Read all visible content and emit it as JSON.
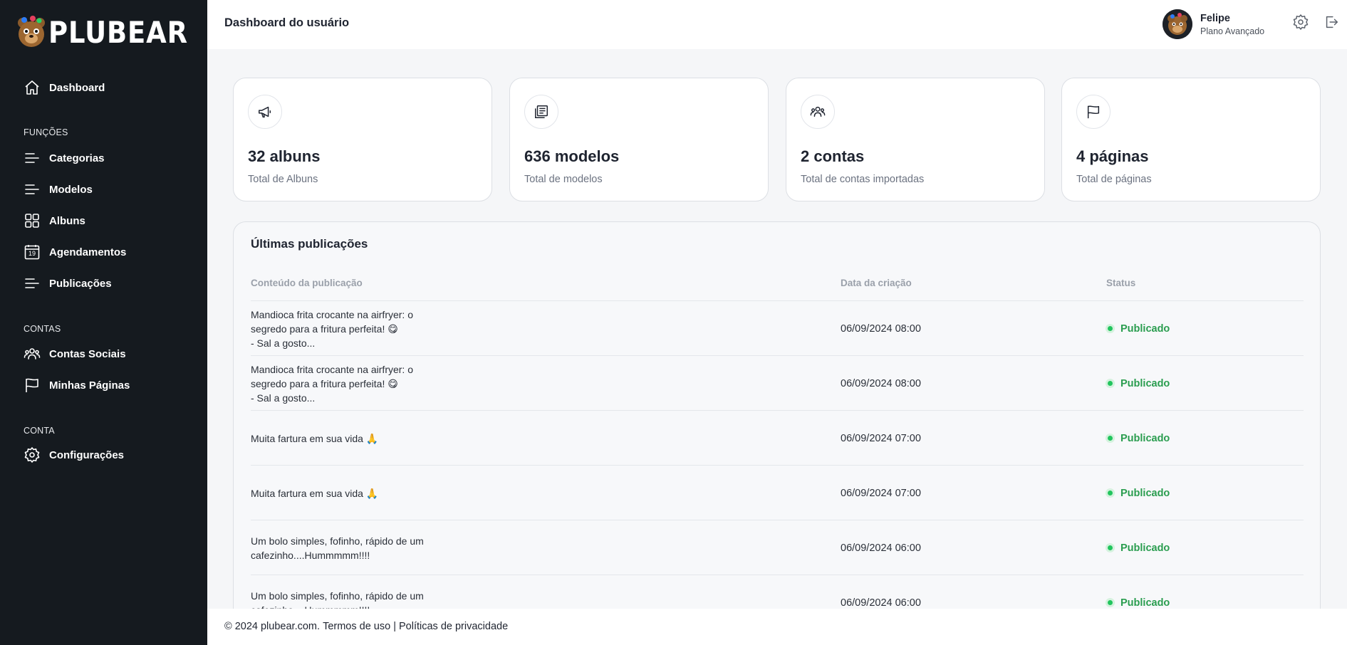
{
  "app": {
    "brand": "PLUBEAR",
    "page_title": "Dashboard do usuário"
  },
  "sidebar": {
    "dashboard": "Dashboard",
    "sections": {
      "funcoes": "FUNÇÕES",
      "contas": "CONTAS",
      "conta": "CONTA"
    },
    "items": {
      "categorias": "Categorias",
      "modelos": "Modelos",
      "albuns": "Albuns",
      "agendamentos": "Agendamentos",
      "agendamentos_icon_number": "19",
      "publicacoes": "Publicações",
      "contas_sociais": "Contas Sociais",
      "minhas_paginas": "Minhas Páginas",
      "configuracoes": "Configurações"
    }
  },
  "user": {
    "name": "Felipe",
    "plan": "Plano Avançado"
  },
  "stats": [
    {
      "value": "32 albuns",
      "caption": "Total de Albuns",
      "icon": "megaphone-icon"
    },
    {
      "value": "636 modelos",
      "caption": "Total de modelos",
      "icon": "newspaper-icon"
    },
    {
      "value": "2 contas",
      "caption": "Total de contas importadas",
      "icon": "users-icon"
    },
    {
      "value": "4 páginas",
      "caption": "Total de páginas",
      "icon": "flag-icon"
    }
  ],
  "publications": {
    "title": "Últimas publicações",
    "columns": {
      "content": "Conteúdo da publicação",
      "date": "Data da criação",
      "status": "Status"
    },
    "rows": [
      {
        "content": "Mandioca frita crocante na airfryer: o\nsegredo para a fritura perfeita! 😋\n- Sal a gosto...",
        "date": "06/09/2024 08:00",
        "status": "Publicado"
      },
      {
        "content": "Mandioca frita crocante na airfryer: o\nsegredo para a fritura perfeita! 😋\n- Sal a gosto...",
        "date": "06/09/2024 08:00",
        "status": "Publicado"
      },
      {
        "content": "Muita fartura em sua vida 🙏",
        "date": "06/09/2024 07:00",
        "status": "Publicado"
      },
      {
        "content": "Muita fartura em sua vida 🙏",
        "date": "06/09/2024 07:00",
        "status": "Publicado"
      },
      {
        "content": "Um bolo simples, fofinho, rápido de um\ncafezinho....Hummmmm!!!!",
        "date": "06/09/2024 06:00",
        "status": "Publicado"
      },
      {
        "content": "Um bolo simples, fofinho, rápido de um\ncafezinho....Hummmmm!!!!",
        "date": "06/09/2024 06:00",
        "status": "Publicado"
      }
    ]
  },
  "footer": {
    "copyright": "© 2024 plubear.com. ",
    "terms": "Termos de uso",
    "separator": " | ",
    "privacy": "Políticas de privacidade"
  },
  "colors": {
    "sidebar_bg": "#151a1f",
    "status_green": "#2a9d4f",
    "page_bg": "#f5f6f8"
  }
}
